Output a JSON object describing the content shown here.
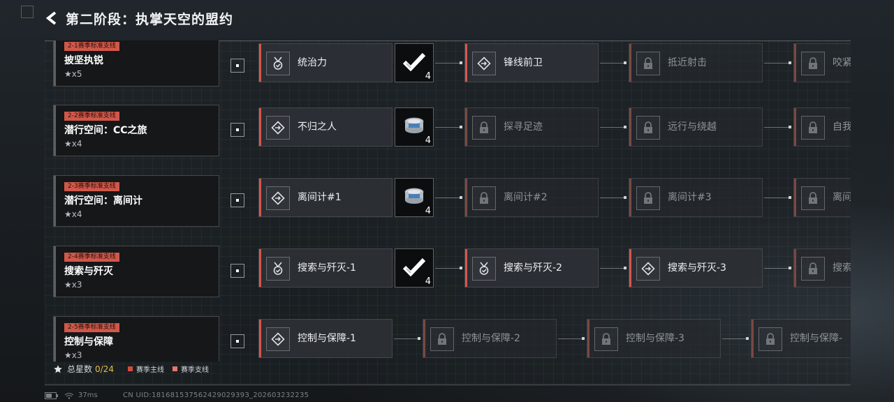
{
  "header": {
    "title": "第二阶段：执掌天空的盟约"
  },
  "rows": [
    {
      "tag": "2-1赛季标准支线",
      "title": "披坚执锐",
      "stars": "x5",
      "nodes": [
        {
          "label": "统治力",
          "icon": "medal-icon",
          "locked": false
        },
        {
          "label": "锋线前卫",
          "icon": "diamond-arrow-icon",
          "locked": false
        },
        {
          "label": "抵近射击",
          "icon": "lock-icon",
          "locked": true
        },
        {
          "label": "咬紧",
          "icon": "lock-icon",
          "locked": true
        }
      ],
      "reward": {
        "type": "checkmark-reward-icon",
        "count": "4"
      }
    },
    {
      "tag": "2-2赛季标准支线",
      "title": "潜行空间：CC之旅",
      "stars": "x4",
      "nodes": [
        {
          "label": "不归之人",
          "icon": "diamond-arrow-icon",
          "locked": false
        },
        {
          "label": "探寻足迹",
          "icon": "lock-icon",
          "locked": true
        },
        {
          "label": "远行与绕越",
          "icon": "lock-icon",
          "locked": true
        },
        {
          "label": "自我",
          "icon": "lock-icon",
          "locked": true
        }
      ],
      "reward": {
        "type": "tin-can-reward-icon",
        "count": "4"
      }
    },
    {
      "tag": "2-3赛季标准支线",
      "title": "潜行空间：离间计",
      "stars": "x4",
      "nodes": [
        {
          "label": "离间计#1",
          "icon": "diamond-arrow-icon",
          "locked": false
        },
        {
          "label": "离间计#2",
          "icon": "lock-icon",
          "locked": true
        },
        {
          "label": "离间计#3",
          "icon": "lock-icon",
          "locked": true
        },
        {
          "label": "离间",
          "icon": "lock-icon",
          "locked": true
        }
      ],
      "reward": {
        "type": "tin-can-reward-icon",
        "count": "4"
      }
    },
    {
      "tag": "2-4赛季标准支线",
      "title": "搜索与歼灭",
      "stars": "x3",
      "nodes": [
        {
          "label": "搜索与歼灭-1",
          "icon": "medal-icon",
          "locked": false
        },
        {
          "label": "搜索与歼灭-2",
          "icon": "medal-icon",
          "locked": false
        },
        {
          "label": "搜索与歼灭-3",
          "icon": "diamond-arrow-icon",
          "locked": false
        },
        {
          "label": "搜索",
          "icon": "lock-icon",
          "locked": true
        }
      ],
      "reward": {
        "type": "checkmark-reward-icon",
        "count": "4"
      }
    },
    {
      "tag": "2-5赛季标准支线",
      "title": "控制与保障",
      "stars": "x3",
      "nodes": [
        {
          "label": "控制与保障-1",
          "icon": "diamond-arrow-icon",
          "locked": false
        },
        {
          "label": "控制与保障-2",
          "icon": "lock-icon",
          "locked": true
        },
        {
          "label": "控制与保障-3",
          "icon": "lock-icon",
          "locked": true
        },
        {
          "label": "控制与保障-",
          "icon": "lock-icon",
          "locked": true
        }
      ],
      "reward": null
    }
  ],
  "footer": {
    "total_label": "总星数",
    "total_value": "0/24",
    "legend": [
      {
        "label": "赛季主线",
        "color": "#d34a3e"
      },
      {
        "label": "赛季支线",
        "color": "#e8766a"
      }
    ]
  },
  "status": {
    "ping": "37ms",
    "uid": "CN UID:18168153756242902939З_202603232235"
  }
}
